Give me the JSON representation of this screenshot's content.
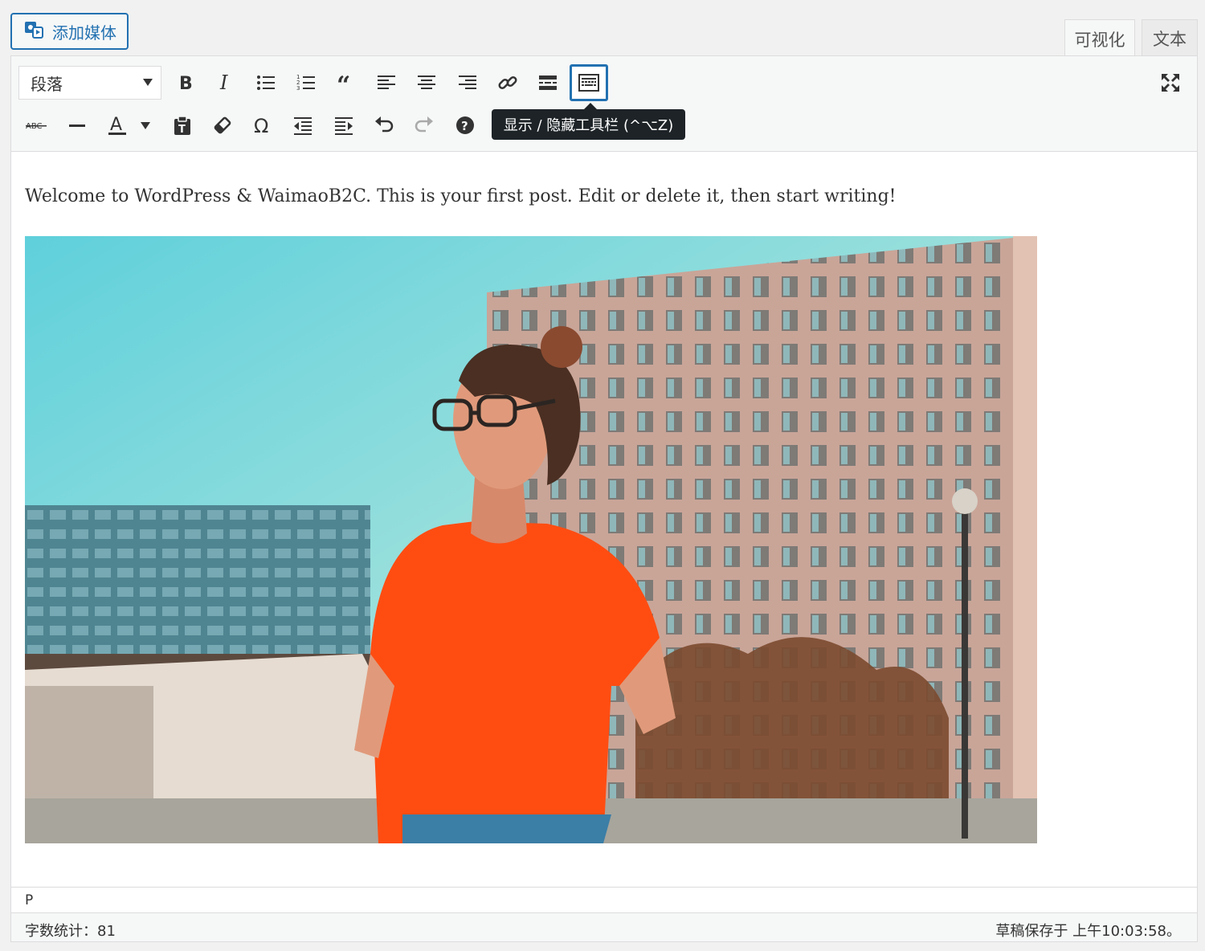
{
  "add_media": {
    "label": "添加媒体"
  },
  "tabs": {
    "visual": "可视化",
    "text": "文本"
  },
  "toolbar": {
    "format_select": "段落",
    "tooltip": "显示 / 隐藏工具栏 (^⌥Z)",
    "strikethrough_glyph": "ABC"
  },
  "content": {
    "paragraph": "Welcome to WordPress & WaimaoB2C. This is your first post. Edit or delete it, then start writing!"
  },
  "path_bar": {
    "path": "P"
  },
  "status": {
    "word_count": "字数统计：81",
    "draft_saved": "草稿保存于 上午10:03:58。"
  },
  "colors": {
    "accent": "#2271b1",
    "tooltip_bg": "#1d2327",
    "shirt": "#ff4d12",
    "sky": "#5fd0db"
  }
}
